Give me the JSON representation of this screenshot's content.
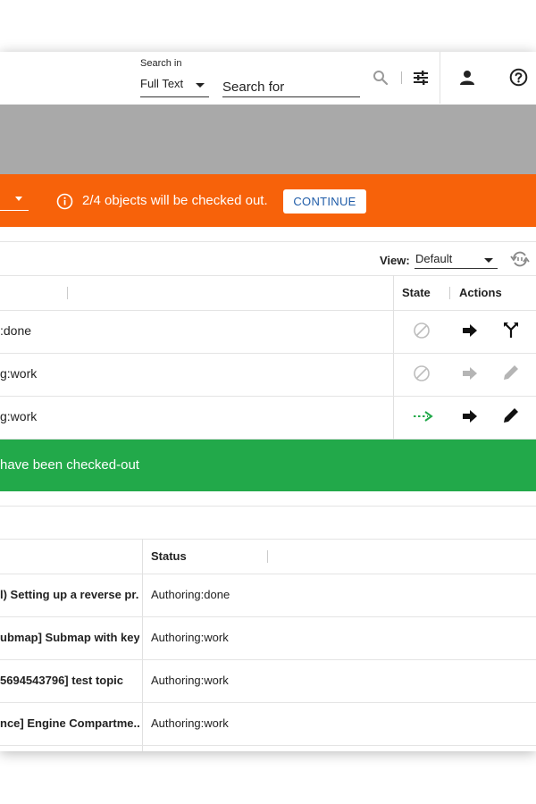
{
  "header": {
    "search_in_label": "Search in",
    "scope_value": "Full Text",
    "search_placeholder": "Search for",
    "icons": [
      "search-icon",
      "filter-settings-icon",
      "user-icon",
      "help-icon"
    ]
  },
  "checkout_banner": {
    "message": "2/4 objects will be checked out.",
    "continue_label": "CONTINUE",
    "color": "#f7620a"
  },
  "view": {
    "label": "View:",
    "value": "Default"
  },
  "table1": {
    "headers": {
      "state": "State",
      "actions": "Actions"
    },
    "rows": [
      {
        "text": ":done",
        "state_icon": "blocked-icon",
        "action1_icon": "arrow-right-icon",
        "action2_icon": "merge-icon",
        "action_enabled": true
      },
      {
        "text": "g:work",
        "state_icon": "blocked-icon",
        "action1_icon": "arrow-right-icon",
        "action2_icon": "pencil-icon",
        "action_enabled": false
      },
      {
        "text": "g:work",
        "state_icon": "dashed-arrow-icon",
        "action1_icon": "arrow-right-icon",
        "action2_icon": "pencil-icon",
        "action_enabled": true
      }
    ]
  },
  "success_banner": {
    "message": "have been checked-out",
    "color": "#22a94a"
  },
  "table2": {
    "headers": {
      "status": "Status"
    },
    "rows": [
      {
        "title": "l) Setting up a reverse pr...",
        "status": "Authoring:done"
      },
      {
        "title": "ubmap] Submap with key...",
        "status": "Authoring:work"
      },
      {
        "title": "5694543796] test topic",
        "status": "Authoring:work"
      },
      {
        "title": "nce] Engine Compartme...",
        "status": "Authoring:work"
      }
    ]
  }
}
